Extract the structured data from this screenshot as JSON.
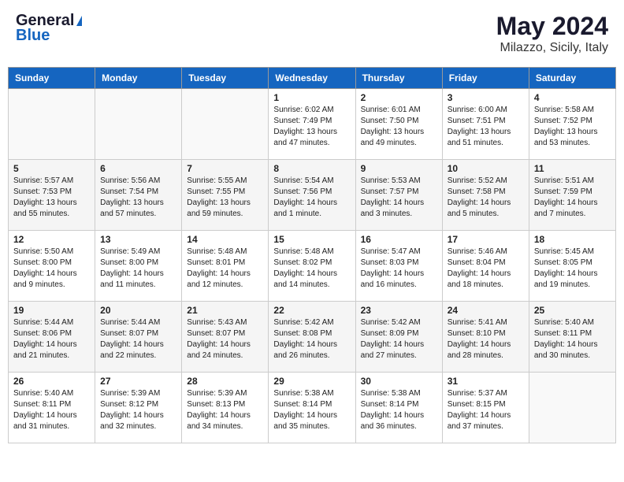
{
  "header": {
    "logo_general": "General",
    "logo_blue": "Blue",
    "month_title": "May 2024",
    "location": "Milazzo, Sicily, Italy"
  },
  "calendar": {
    "days_of_week": [
      "Sunday",
      "Monday",
      "Tuesday",
      "Wednesday",
      "Thursday",
      "Friday",
      "Saturday"
    ],
    "weeks": [
      {
        "cells": [
          {
            "day": "",
            "info": ""
          },
          {
            "day": "",
            "info": ""
          },
          {
            "day": "",
            "info": ""
          },
          {
            "day": "1",
            "info": "Sunrise: 6:02 AM\nSunset: 7:49 PM\nDaylight: 13 hours\nand 47 minutes."
          },
          {
            "day": "2",
            "info": "Sunrise: 6:01 AM\nSunset: 7:50 PM\nDaylight: 13 hours\nand 49 minutes."
          },
          {
            "day": "3",
            "info": "Sunrise: 6:00 AM\nSunset: 7:51 PM\nDaylight: 13 hours\nand 51 minutes."
          },
          {
            "day": "4",
            "info": "Sunrise: 5:58 AM\nSunset: 7:52 PM\nDaylight: 13 hours\nand 53 minutes."
          }
        ]
      },
      {
        "cells": [
          {
            "day": "5",
            "info": "Sunrise: 5:57 AM\nSunset: 7:53 PM\nDaylight: 13 hours\nand 55 minutes."
          },
          {
            "day": "6",
            "info": "Sunrise: 5:56 AM\nSunset: 7:54 PM\nDaylight: 13 hours\nand 57 minutes."
          },
          {
            "day": "7",
            "info": "Sunrise: 5:55 AM\nSunset: 7:55 PM\nDaylight: 13 hours\nand 59 minutes."
          },
          {
            "day": "8",
            "info": "Sunrise: 5:54 AM\nSunset: 7:56 PM\nDaylight: 14 hours\nand 1 minute."
          },
          {
            "day": "9",
            "info": "Sunrise: 5:53 AM\nSunset: 7:57 PM\nDaylight: 14 hours\nand 3 minutes."
          },
          {
            "day": "10",
            "info": "Sunrise: 5:52 AM\nSunset: 7:58 PM\nDaylight: 14 hours\nand 5 minutes."
          },
          {
            "day": "11",
            "info": "Sunrise: 5:51 AM\nSunset: 7:59 PM\nDaylight: 14 hours\nand 7 minutes."
          }
        ]
      },
      {
        "cells": [
          {
            "day": "12",
            "info": "Sunrise: 5:50 AM\nSunset: 8:00 PM\nDaylight: 14 hours\nand 9 minutes."
          },
          {
            "day": "13",
            "info": "Sunrise: 5:49 AM\nSunset: 8:00 PM\nDaylight: 14 hours\nand 11 minutes."
          },
          {
            "day": "14",
            "info": "Sunrise: 5:48 AM\nSunset: 8:01 PM\nDaylight: 14 hours\nand 12 minutes."
          },
          {
            "day": "15",
            "info": "Sunrise: 5:48 AM\nSunset: 8:02 PM\nDaylight: 14 hours\nand 14 minutes."
          },
          {
            "day": "16",
            "info": "Sunrise: 5:47 AM\nSunset: 8:03 PM\nDaylight: 14 hours\nand 16 minutes."
          },
          {
            "day": "17",
            "info": "Sunrise: 5:46 AM\nSunset: 8:04 PM\nDaylight: 14 hours\nand 18 minutes."
          },
          {
            "day": "18",
            "info": "Sunrise: 5:45 AM\nSunset: 8:05 PM\nDaylight: 14 hours\nand 19 minutes."
          }
        ]
      },
      {
        "cells": [
          {
            "day": "19",
            "info": "Sunrise: 5:44 AM\nSunset: 8:06 PM\nDaylight: 14 hours\nand 21 minutes."
          },
          {
            "day": "20",
            "info": "Sunrise: 5:44 AM\nSunset: 8:07 PM\nDaylight: 14 hours\nand 22 minutes."
          },
          {
            "day": "21",
            "info": "Sunrise: 5:43 AM\nSunset: 8:07 PM\nDaylight: 14 hours\nand 24 minutes."
          },
          {
            "day": "22",
            "info": "Sunrise: 5:42 AM\nSunset: 8:08 PM\nDaylight: 14 hours\nand 26 minutes."
          },
          {
            "day": "23",
            "info": "Sunrise: 5:42 AM\nSunset: 8:09 PM\nDaylight: 14 hours\nand 27 minutes."
          },
          {
            "day": "24",
            "info": "Sunrise: 5:41 AM\nSunset: 8:10 PM\nDaylight: 14 hours\nand 28 minutes."
          },
          {
            "day": "25",
            "info": "Sunrise: 5:40 AM\nSunset: 8:11 PM\nDaylight: 14 hours\nand 30 minutes."
          }
        ]
      },
      {
        "cells": [
          {
            "day": "26",
            "info": "Sunrise: 5:40 AM\nSunset: 8:11 PM\nDaylight: 14 hours\nand 31 minutes."
          },
          {
            "day": "27",
            "info": "Sunrise: 5:39 AM\nSunset: 8:12 PM\nDaylight: 14 hours\nand 32 minutes."
          },
          {
            "day": "28",
            "info": "Sunrise: 5:39 AM\nSunset: 8:13 PM\nDaylight: 14 hours\nand 34 minutes."
          },
          {
            "day": "29",
            "info": "Sunrise: 5:38 AM\nSunset: 8:14 PM\nDaylight: 14 hours\nand 35 minutes."
          },
          {
            "day": "30",
            "info": "Sunrise: 5:38 AM\nSunset: 8:14 PM\nDaylight: 14 hours\nand 36 minutes."
          },
          {
            "day": "31",
            "info": "Sunrise: 5:37 AM\nSunset: 8:15 PM\nDaylight: 14 hours\nand 37 minutes."
          },
          {
            "day": "",
            "info": ""
          }
        ]
      }
    ]
  }
}
